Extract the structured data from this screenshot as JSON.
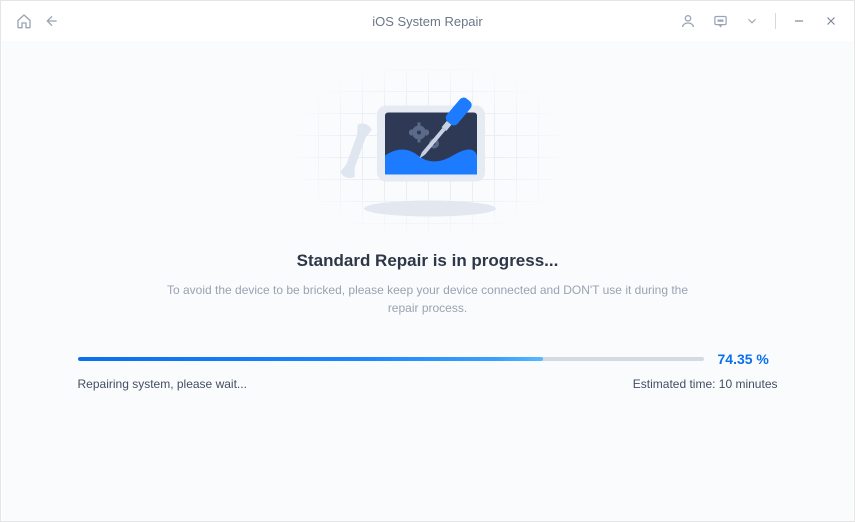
{
  "header": {
    "title": "iOS System Repair"
  },
  "main": {
    "heading": "Standard Repair is in progress...",
    "subtext": "To avoid the device to be bricked, please keep your device connected and DON'T use it during the repair process."
  },
  "progress": {
    "percent_display": "74.35 %",
    "percent_value": 74.35,
    "status_text": "Repairing system, please wait...",
    "eta_text": "Estimated time: 10 minutes"
  },
  "icons": {
    "home": "home-icon",
    "back": "back-icon",
    "user": "user-icon",
    "feedback": "chat-icon",
    "dropdown": "chevron-down-icon",
    "minimize": "minimize-icon",
    "close": "close-icon"
  }
}
